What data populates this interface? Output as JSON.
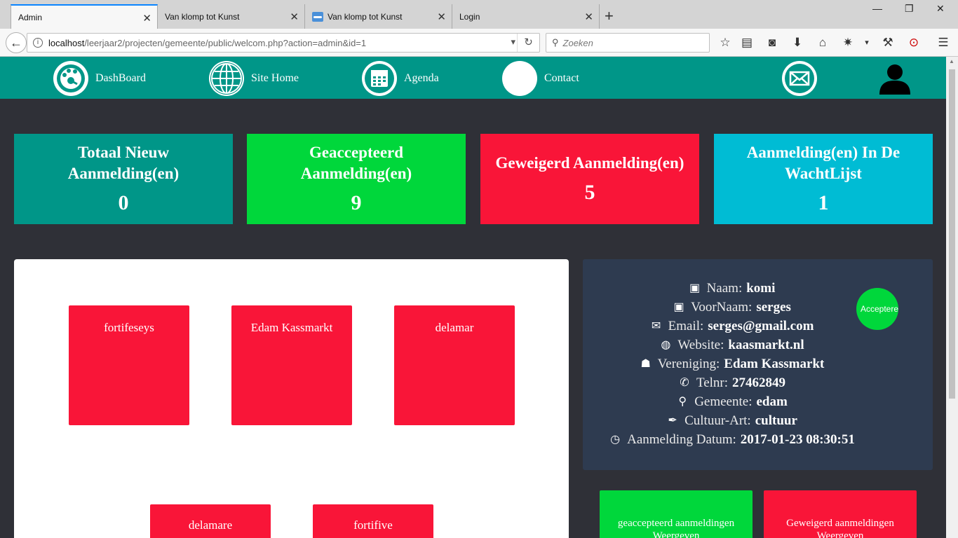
{
  "browser": {
    "tabs": [
      {
        "label": "Admin",
        "active": true
      },
      {
        "label": "Van klomp tot Kunst",
        "active": false
      },
      {
        "label": "Van klomp tot Kunst",
        "active": false
      },
      {
        "label": "Login",
        "active": false
      }
    ],
    "url_host": "localhost",
    "url_path": "/leerjaar2/projecten/gemeente/public/welcom.php?action=admin&id=1",
    "search_placeholder": "Zoeken"
  },
  "nav": {
    "dashboard": "DashBoard",
    "site_home": "Site Home",
    "agenda": "Agenda",
    "contact": "Contact"
  },
  "stats": [
    {
      "label": "Totaal Nieuw Aanmelding(en)",
      "value": "0",
      "color": "#009688"
    },
    {
      "label": "Geaccepteerd Aanmelding(en)",
      "value": "9",
      "color": "#00d73b"
    },
    {
      "label": "Geweigerd Aanmelding(en)",
      "value": "5",
      "color": "#f91538"
    },
    {
      "label": "Aanmelding(en) In De WachtLijst",
      "value": "1",
      "color": "#00bcd4"
    }
  ],
  "tiles": [
    "fortifeseys",
    "Edam Kassmarkt",
    "delamar",
    "delamare",
    "fortifive"
  ],
  "detail": {
    "naam_label": "Naam:",
    "naam": "komi",
    "voornaam_label": "VoorNaam:",
    "voornaam": "serges",
    "email_label": "Email:",
    "email": "serges@gmail.com",
    "website_label": "Website:",
    "website": "kaasmarkt.nl",
    "vereniging_label": "Vereniging:",
    "vereniging": "Edam Kassmarkt",
    "telnr_label": "Telnr:",
    "telnr": "27462849",
    "gemeente_label": "Gemeente:",
    "gemeente": "edam",
    "cultuur_label": "Cultuur-Art:",
    "cultuur": "cultuur",
    "datum_label": "Aanmelding Datum:",
    "datum": "2017-01-23 08:30:51",
    "accept_label": "Accepteren"
  },
  "buttons": {
    "accepted": "geaccepteerd aanmeldingen Weergeven",
    "refused": "Geweigerd aanmeldingen Weergeven"
  },
  "colors": {
    "teal": "#009688",
    "green": "#00d73b",
    "red": "#f91538",
    "cyan": "#00bcd4",
    "panel": "#2e3b50",
    "page_bg": "#2f3037"
  }
}
